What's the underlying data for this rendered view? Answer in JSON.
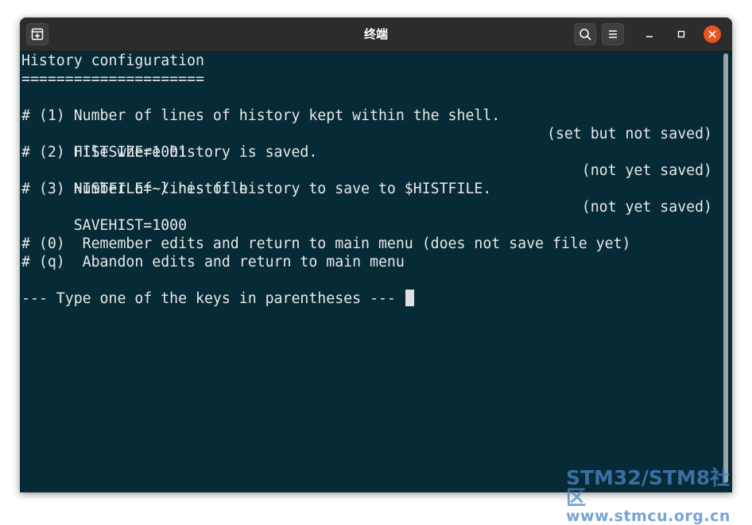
{
  "window": {
    "title": "终端"
  },
  "terminal": {
    "heading": "History configuration",
    "underline": "=====================",
    "items": [
      {
        "comment": "# (1) Number of lines of history kept within the shell.",
        "setting": "HISTSIZE=1001",
        "status": "(set but not saved)"
      },
      {
        "comment": "# (2) File where history is saved.",
        "setting": "HISTFILE=~/.histfile",
        "status": "(not yet saved)"
      },
      {
        "comment": "# (3) Number of lines of history to save to $HISTFILE.",
        "setting": "SAVEHIST=1000",
        "status": "(not yet saved)"
      }
    ],
    "options": [
      "# (0)  Remember edits and return to main menu (does not save file yet)",
      "# (q)  Abandon edits and return to main menu"
    ],
    "prompt": "--- Type one of the keys in parentheses --- "
  },
  "watermark": {
    "line1": "STM32/STM8社区",
    "line2": "www.stmcu.org.cn"
  }
}
